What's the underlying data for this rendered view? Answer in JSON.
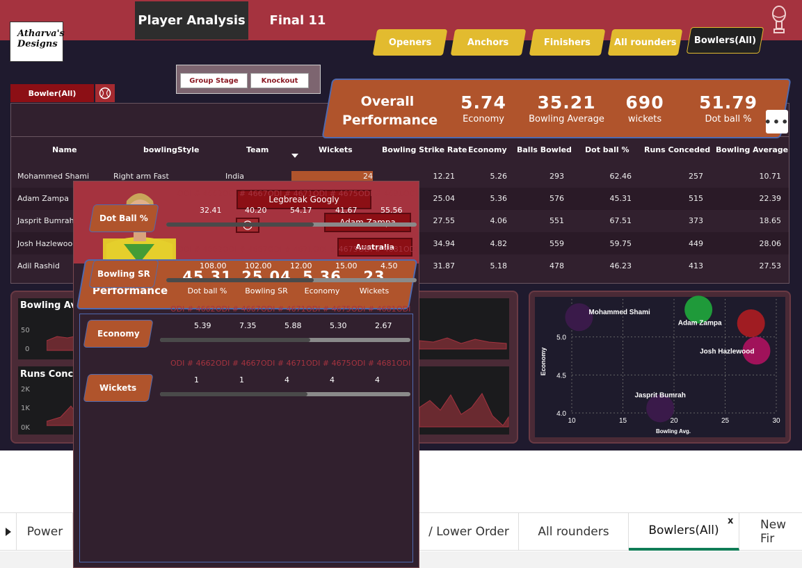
{
  "brand": {
    "line1": "Atharva's",
    "line2": "Designs"
  },
  "nav": {
    "player_analysis": "Player Analysis",
    "final11": "Final 11"
  },
  "role_chips": [
    "Openers",
    "Anchors",
    "Finishers",
    "All rounders",
    "Bowlers(All)"
  ],
  "stage": {
    "group": "Group Stage",
    "knockout": "Knockout"
  },
  "bowler_filter": "Bowler(All)",
  "overall": {
    "title": "Overall Performance",
    "kpis": [
      {
        "value": "5.74",
        "label": "Economy"
      },
      {
        "value": "35.21",
        "label": "Bowling Average"
      },
      {
        "value": "690",
        "label": "wickets"
      },
      {
        "value": "51.79",
        "label": "Dot ball %"
      }
    ]
  },
  "more_button": "•••",
  "table": {
    "headers": [
      "Name",
      "bowlingStyle",
      "Team",
      "Wickets",
      "Bowling Strike Rate",
      "Economy",
      "Balls Bowled",
      "Dot ball %",
      "Runs Conceded",
      "Bowling Average"
    ],
    "rows": [
      [
        "Mohammed Shami",
        "Right arm Fast",
        "India",
        "24",
        "12.21",
        "5.26",
        "293",
        "62.46",
        "257",
        "10.71"
      ],
      [
        "Adam Zampa",
        "",
        "",
        "",
        "25.04",
        "5.36",
        "576",
        "45.31",
        "515",
        "22.39"
      ],
      [
        "Jasprit Bumrah",
        "",
        "",
        "",
        "27.55",
        "4.06",
        "551",
        "67.51",
        "373",
        "18.65"
      ],
      [
        "Josh Hazlewood",
        "",
        "",
        "",
        "34.94",
        "4.82",
        "559",
        "59.75",
        "449",
        "28.06"
      ],
      [
        "Adil Rashid",
        "",
        "",
        "",
        "31.87",
        "5.18",
        "478",
        "46.23",
        "413",
        "27.53"
      ]
    ]
  },
  "charts": {
    "bowling_avg_title": "Bowling Ave",
    "runs_conceded_title": "Runs Conce",
    "bowling_avg_ticks": [
      "50",
      "0"
    ],
    "runs_ticks": [
      "2K",
      "1K",
      "0K"
    ]
  },
  "chart_data": {
    "type": "scatter",
    "xlabel": "Bowling Avg.",
    "ylabel": "Economy",
    "xlim": [
      10,
      30
    ],
    "ylim": [
      4.0,
      5.5
    ],
    "x_ticks": [
      "10",
      "15",
      "20",
      "25",
      "30"
    ],
    "y_ticks": [
      "5.0",
      "4.5",
      "4.0"
    ],
    "points": [
      {
        "name": "Mohammed Shami",
        "x": 10.71,
        "y": 5.26,
        "color": "#3a1a4a"
      },
      {
        "name": "Adam Zampa",
        "x": 22.39,
        "y": 5.36,
        "color": "#1f9a3a"
      },
      {
        "name": "",
        "x": 27.53,
        "y": 5.18,
        "color": "#a01c22"
      },
      {
        "name": "Josh Hazlewood",
        "x": 28.06,
        "y": 4.82,
        "color": "#a0125a"
      },
      {
        "name": "Jasprit Bumrah",
        "x": 18.65,
        "y": 4.06,
        "color": "#3a1a4a"
      }
    ]
  },
  "tooltip": {
    "style": "Legbreak Googly",
    "player": "Adam Zampa",
    "team": "Australia",
    "overall_title": "Overall Performance",
    "kpis": [
      {
        "value": "45.31",
        "label": "Dot ball %"
      },
      {
        "value": "25.04",
        "label": "Bowling SR"
      },
      {
        "value": "5.36",
        "label": "Economy"
      },
      {
        "value": "23",
        "label": "Wickets"
      }
    ],
    "metrics": [
      {
        "label": "Dot Ball %",
        "matches": [
          "ODI # 4662",
          "ODI # 4667",
          "ODI # 4671",
          "ODI # 4675",
          "ODI # 4681",
          "ODI"
        ],
        "values": [
          "32.41",
          "40.20",
          "54.17",
          "41.67",
          "55.56"
        ],
        "progress": 0.59
      },
      {
        "label": "Bowling SR",
        "matches": [
          "ODI # 4662",
          "ODI # 4667",
          "ODI # 4671",
          "ODI # 4675",
          "ODI # 4681",
          "ODI"
        ],
        "values": [
          "108.00",
          "102.00",
          "12.00",
          "15.00",
          "4.50"
        ],
        "progress": 0.59
      },
      {
        "label": "Economy",
        "matches": [
          "ODI # 4662",
          "ODI # 4667",
          "ODI # 4671",
          "ODI # 4675",
          "ODI # 4681",
          "ODI"
        ],
        "values": [
          "5.39",
          "7.35",
          "5.88",
          "5.30",
          "2.67"
        ],
        "progress": 0.6
      },
      {
        "label": "Wickets",
        "matches": [
          "ODI # 4662",
          "ODI # 4667",
          "ODI # 4671",
          "ODI # 4675",
          "ODI # 4681",
          "ODI"
        ],
        "values": [
          "1",
          "1",
          "4",
          "4",
          "4"
        ],
        "progress": 0.59
      }
    ]
  },
  "sheet_tabs": [
    "Power",
    "/ Lower Order",
    "All rounders",
    "Bowlers(All)",
    "New Fir"
  ],
  "sheet_close": "x"
}
